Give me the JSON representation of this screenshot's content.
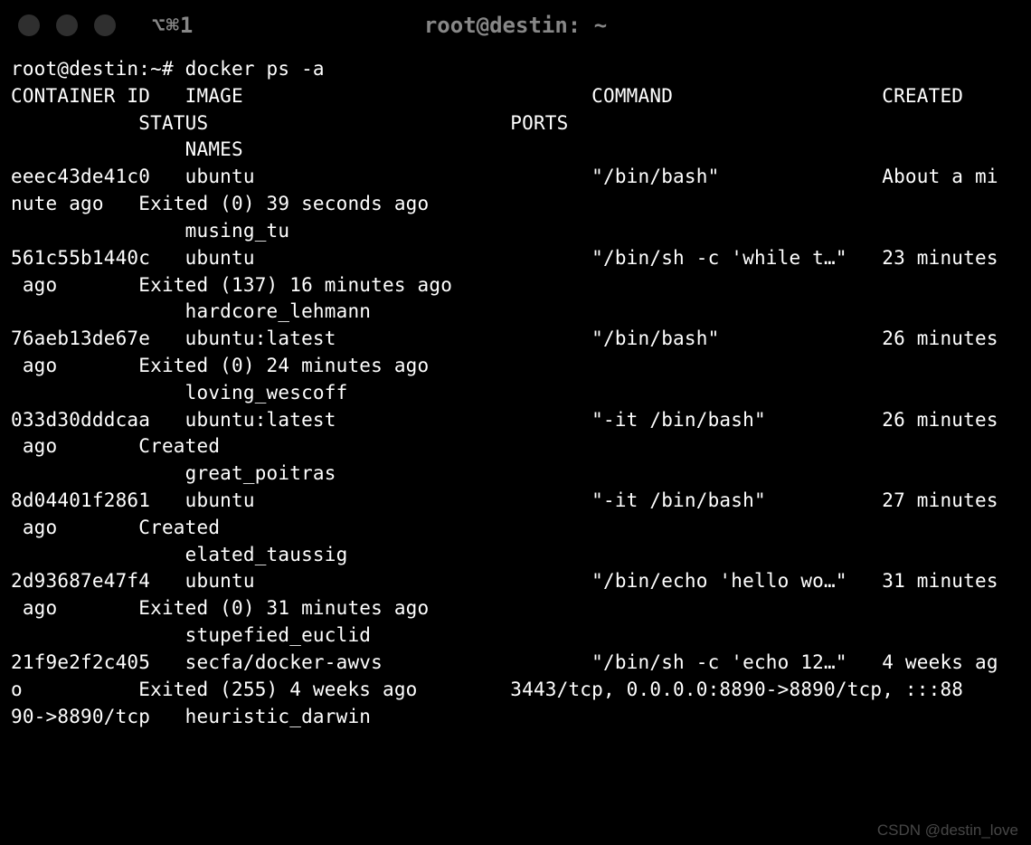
{
  "titlebar": {
    "tab_label": "⌥⌘1",
    "window_title": "root@destin: ~"
  },
  "prompt": "root@destin:~# ",
  "command": "docker ps -a",
  "header": {
    "line1": "CONTAINER ID   IMAGE                              COMMAND                  CREATED",
    "line2": "           STATUS                          PORTS",
    "line3": "               NAMES"
  },
  "rows": [
    {
      "l1": "eeec43de41c0   ubuntu                             \"/bin/bash\"              About a mi",
      "l2": "nute ago   Exited (0) 39 seconds ago",
      "l3": "               musing_tu"
    },
    {
      "l1": "561c55b1440c   ubuntu                             \"/bin/sh -c 'while t…\"   23 minutes",
      "l2": " ago       Exited (137) 16 minutes ago",
      "l3": "               hardcore_lehmann"
    },
    {
      "l1": "76aeb13de67e   ubuntu:latest                      \"/bin/bash\"              26 minutes",
      "l2": " ago       Exited (0) 24 minutes ago",
      "l3": "               loving_wescoff"
    },
    {
      "l1": "033d30dddcaa   ubuntu:latest                      \"-it /bin/bash\"          26 minutes",
      "l2": " ago       Created",
      "l3": "               great_poitras"
    },
    {
      "l1": "8d04401f2861   ubuntu                             \"-it /bin/bash\"          27 minutes",
      "l2": " ago       Created",
      "l3": "               elated_taussig"
    },
    {
      "l1": "2d93687e47f4   ubuntu                             \"/bin/echo 'hello wo…\"   31 minutes",
      "l2": " ago       Exited (0) 31 minutes ago",
      "l3": "               stupefied_euclid"
    },
    {
      "l1": "21f9e2f2c405   secfa/docker-awvs                  \"/bin/sh -c 'echo 12…\"   4 weeks ag",
      "l2": "o          Exited (255) 4 weeks ago        3443/tcp, 0.0.0.0:8890->8890/tcp, :::88",
      "l3": "90->8890/tcp   heuristic_darwin"
    }
  ],
  "watermark": "CSDN @destin_love"
}
